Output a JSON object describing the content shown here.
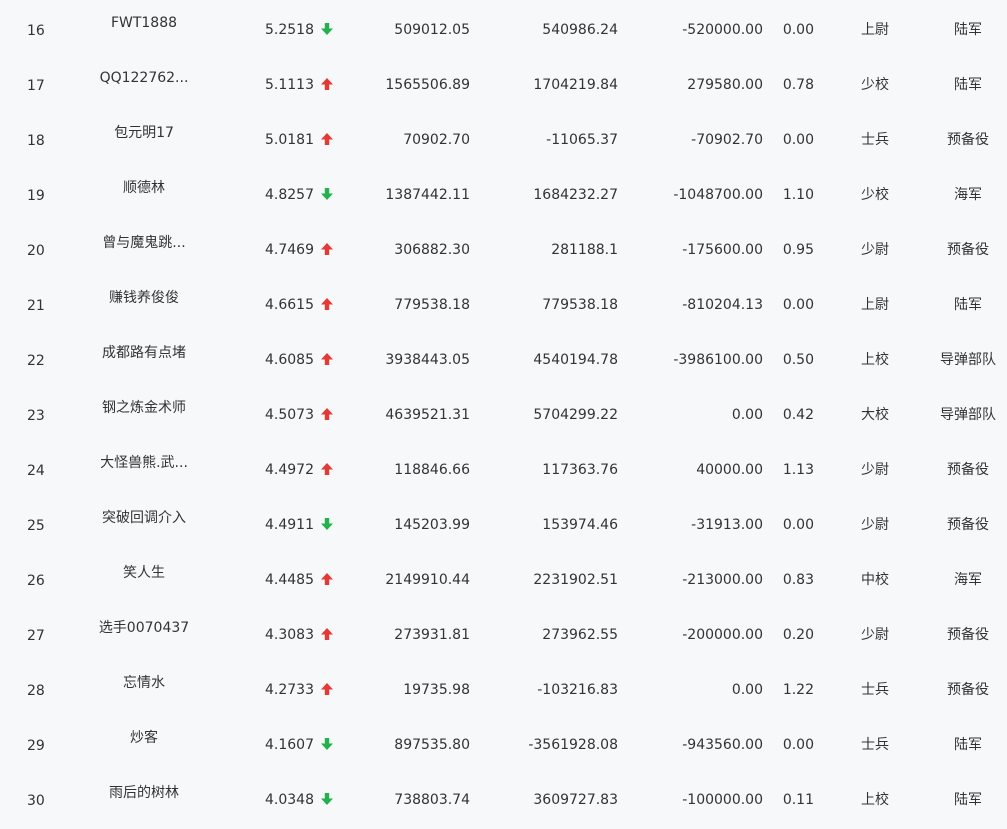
{
  "colors": {
    "up": "#e53935",
    "down": "#22b14c",
    "text": "#333333",
    "background": "#f7f8fa"
  },
  "rows": [
    {
      "rank": "16",
      "name": "FWT1888",
      "rate": "5.2518",
      "trend": "down",
      "v1": "509012.05",
      "v2": "540986.24",
      "v3": "-520000.00",
      "ratio": "0.00",
      "title": "上尉",
      "branch": "陆军"
    },
    {
      "rank": "17",
      "name": "QQ122762...",
      "rate": "5.1113",
      "trend": "up",
      "v1": "1565506.89",
      "v2": "1704219.84",
      "v3": "279580.00",
      "ratio": "0.78",
      "title": "少校",
      "branch": "陆军"
    },
    {
      "rank": "18",
      "name": "包元明17",
      "rate": "5.0181",
      "trend": "up",
      "v1": "70902.70",
      "v2": "-11065.37",
      "v3": "-70902.70",
      "ratio": "0.00",
      "title": "士兵",
      "branch": "预备役"
    },
    {
      "rank": "19",
      "name": "顺德林",
      "rate": "4.8257",
      "trend": "down",
      "v1": "1387442.11",
      "v2": "1684232.27",
      "v3": "-1048700.00",
      "ratio": "1.10",
      "title": "少校",
      "branch": "海军"
    },
    {
      "rank": "20",
      "name": "曾与魔鬼跳...",
      "rate": "4.7469",
      "trend": "up",
      "v1": "306882.30",
      "v2": "281188.1",
      "v3": "-175600.00",
      "ratio": "0.95",
      "title": "少尉",
      "branch": "预备役"
    },
    {
      "rank": "21",
      "name": "赚钱养俊俊",
      "rate": "4.6615",
      "trend": "up",
      "v1": "779538.18",
      "v2": "779538.18",
      "v3": "-810204.13",
      "ratio": "0.00",
      "title": "上尉",
      "branch": "陆军"
    },
    {
      "rank": "22",
      "name": "成都路有点堵",
      "rate": "4.6085",
      "trend": "up",
      "v1": "3938443.05",
      "v2": "4540194.78",
      "v3": "-3986100.00",
      "ratio": "0.50",
      "title": "上校",
      "branch": "导弹部队"
    },
    {
      "rank": "23",
      "name": "钢之炼金术师",
      "rate": "4.5073",
      "trend": "up",
      "v1": "4639521.31",
      "v2": "5704299.22",
      "v3": "0.00",
      "ratio": "0.42",
      "title": "大校",
      "branch": "导弹部队"
    },
    {
      "rank": "24",
      "name": "大怪兽熊.武...",
      "rate": "4.4972",
      "trend": "up",
      "v1": "118846.66",
      "v2": "117363.76",
      "v3": "40000.00",
      "ratio": "1.13",
      "title": "少尉",
      "branch": "预备役"
    },
    {
      "rank": "25",
      "name": "突破回调介入",
      "rate": "4.4911",
      "trend": "down",
      "v1": "145203.99",
      "v2": "153974.46",
      "v3": "-31913.00",
      "ratio": "0.00",
      "title": "少尉",
      "branch": "预备役"
    },
    {
      "rank": "26",
      "name": "笑人生",
      "rate": "4.4485",
      "trend": "up",
      "v1": "2149910.44",
      "v2": "2231902.51",
      "v3": "-213000.00",
      "ratio": "0.83",
      "title": "中校",
      "branch": "海军"
    },
    {
      "rank": "27",
      "name": "选手0070437",
      "rate": "4.3083",
      "trend": "up",
      "v1": "273931.81",
      "v2": "273962.55",
      "v3": "-200000.00",
      "ratio": "0.20",
      "title": "少尉",
      "branch": "预备役"
    },
    {
      "rank": "28",
      "name": "忘情水",
      "rate": "4.2733",
      "trend": "up",
      "v1": "19735.98",
      "v2": "-103216.83",
      "v3": "0.00",
      "ratio": "1.22",
      "title": "士兵",
      "branch": "预备役"
    },
    {
      "rank": "29",
      "name": "炒客",
      "rate": "4.1607",
      "trend": "down",
      "v1": "897535.80",
      "v2": "-3561928.08",
      "v3": "-943560.00",
      "ratio": "0.00",
      "title": "士兵",
      "branch": "陆军"
    },
    {
      "rank": "30",
      "name": "雨后的树林",
      "rate": "4.0348",
      "trend": "down",
      "v1": "738803.74",
      "v2": "3609727.83",
      "v3": "-100000.00",
      "ratio": "0.11",
      "title": "上校",
      "branch": "陆军"
    }
  ]
}
